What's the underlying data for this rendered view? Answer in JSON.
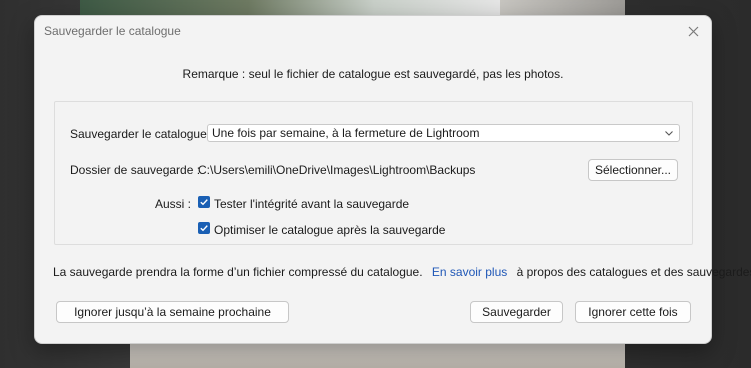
{
  "dialog": {
    "title": "Sauvegarder le catalogue",
    "close_icon": "close-icon",
    "note": "Remarque : seul le fichier de catalogue est sauvegardé, pas les photos."
  },
  "settings": {
    "frequency_label": "Sauvegarder le catalogue :",
    "frequency_value": "Une fois par semaine, à la fermeture de Lightroom",
    "folder_label": "Dossier de sauvegarde :",
    "folder_path": "C:\\Users\\emili\\OneDrive\\Images\\Lightroom\\Backups",
    "select_button": "Sélectionner...",
    "also_label": "Aussi :",
    "options": [
      {
        "label": "Tester l'intégrité avant la sauvegarde",
        "checked": true
      },
      {
        "label": "Optimiser le catalogue après la sauvegarde",
        "checked": true
      }
    ]
  },
  "info": {
    "prefix": "La sauvegarde prendra la forme d’un fichier compressé du catalogue.",
    "link": "En savoir plus",
    "suffix": "à propos des catalogues et des sauvegardes."
  },
  "buttons": {
    "skip_week": "Ignorer jusqu’à la semaine prochaine",
    "save": "Sauvegarder",
    "skip_once": "Ignorer cette fois"
  },
  "colors": {
    "accent": "#1a5fb4",
    "link": "#1f57b7",
    "dialog_bg": "#f3f3f3"
  }
}
